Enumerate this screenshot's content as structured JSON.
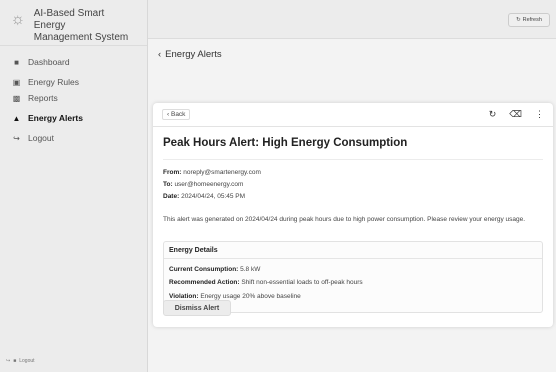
{
  "brand": {
    "title_line1": "AI-Based Smart Energy",
    "title_line2": "Management System"
  },
  "sidebar": {
    "items": [
      {
        "label": "Dashboard"
      },
      {
        "label": "Energy Rules"
      },
      {
        "label": "Reports"
      },
      {
        "label": "Energy Alerts"
      },
      {
        "label": "Logout"
      }
    ],
    "footer_label": "Logout"
  },
  "topbar": {
    "refresh_label": "Refresh"
  },
  "page": {
    "header": "Energy Alerts"
  },
  "alert": {
    "back_label": "Back",
    "title": "Peak Hours Alert: High Energy Consumption",
    "from_label": "From:",
    "from_value": "noreply@smartenergy.com",
    "to_label": "To:",
    "to_value": "user@homeenergy.com",
    "date_label": "Date:",
    "date_value": "2024/04/24, 05:45 PM",
    "message": "This alert was generated on 2024/04/24 during peak hours due to high power consumption. Please review your energy usage.",
    "details": {
      "heading": "Energy Details",
      "current_label": "Current Consumption:",
      "current_value": "5.8 kW",
      "action_label": "Recommended Action:",
      "action_value": "Shift non-essential loads to off-peak hours",
      "violation_label": "Violation:",
      "violation_value": "Energy usage 20% above baseline"
    },
    "dismiss_label": "Dismiss Alert"
  }
}
